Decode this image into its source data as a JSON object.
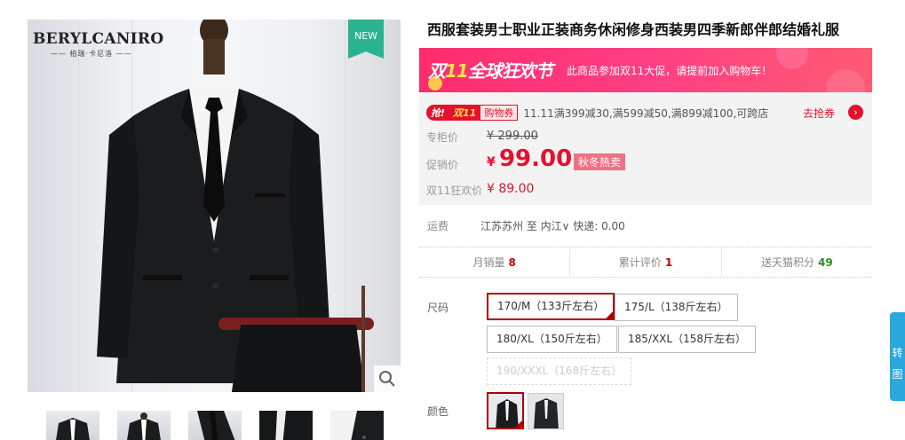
{
  "gallery": {
    "brand": "BERYLCANIRO",
    "brand_sub": "—— 柏瑞·卡尼洛 ——",
    "badge": "NEW",
    "zoom_icon": "magnifier-icon",
    "thumbnails": [
      "suit-front-1",
      "suit-front-2",
      "suit-detail-1",
      "suit-detail-2",
      "suit-detail-3"
    ]
  },
  "product": {
    "title": "西服套装男士职业正装商务休闲修身西装男四季新郎伴郎结婚礼服"
  },
  "promo_banner": {
    "logo_part1": "双",
    "logo_part2": "11",
    "logo_part3": "全球狂欢节",
    "text": "此商品参加双11大促，请提前加入购物车！"
  },
  "price": {
    "coupon_tag1": "抢!",
    "coupon_tag2": "双11",
    "coupon_tag3": "购物券",
    "coupon_text": "11.11满399减30,满599减50,满899减100,可跨店",
    "grab_label": "去抢券",
    "orig_label": "专柜价",
    "orig_value": "¥ 299.00",
    "promo_label": "促销价",
    "promo_currency": "¥",
    "promo_value": "99.00",
    "season_tag": "秋冬热卖",
    "d11_label": "双11狂欢价",
    "d11_value": "¥ 89.00"
  },
  "shipping": {
    "label": "运费",
    "text": "江苏苏州 至 内江∨ 快递: 0.00"
  },
  "stats": [
    {
      "label": "月销量",
      "value": "8",
      "color": "red"
    },
    {
      "label": "累计评价",
      "value": "1",
      "color": "red"
    },
    {
      "label": "送天猫积分",
      "value": "49",
      "color": "green"
    }
  ],
  "sizes": {
    "label": "尺码",
    "options": [
      "170/M（133斤左右）",
      "175/L（138斤左右）",
      "180/XL（150斤左右）",
      "185/XXL（158斤左右）",
      "190/XXXL（168斤左右）"
    ],
    "selected": 0,
    "disabled": 4
  },
  "colors": {
    "label": "颜色",
    "options": [
      "black-suit",
      "black-suit-alt"
    ],
    "selected": 0
  },
  "side_tab": {
    "line1": "转",
    "line2": "图"
  },
  "theme": {
    "accent_red": "#e4112c",
    "selected_border": "#b10000",
    "badge_green": "#29b38e",
    "side_tab_blue": "#2aa7dc"
  }
}
